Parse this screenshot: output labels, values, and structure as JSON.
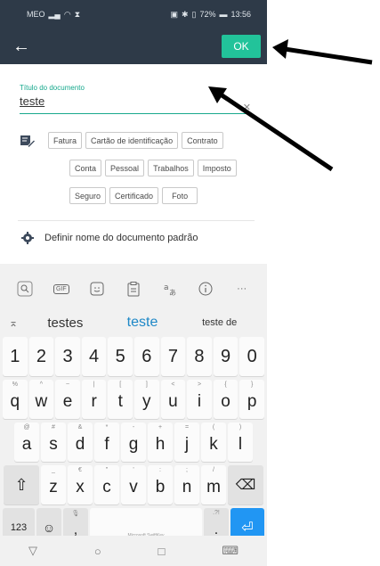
{
  "status_bar": {
    "carrier": "MEO",
    "right_text": "72%",
    "time": "13:56"
  },
  "app_bar": {
    "ok_label": "OK"
  },
  "title_field": {
    "label": "Título do documento",
    "value": "teste",
    "clear_glyph": "✕"
  },
  "tags": [
    "Fatura",
    "Cartão de identificação",
    "Contrato",
    "Conta",
    "Pessoal",
    "Trabalhos",
    "Imposto",
    "Seguro",
    "Certificado",
    "Foto"
  ],
  "default_name": {
    "label": "Definir nome do documento padrão"
  },
  "keyboard": {
    "toolbar": {
      "gif_label": "GIF",
      "more_label": "···"
    },
    "suggestions": [
      "testes",
      "teste",
      "teste de"
    ],
    "number_row": [
      "1",
      "2",
      "3",
      "4",
      "5",
      "6",
      "7",
      "8",
      "9",
      "0"
    ],
    "row1": [
      {
        "key": "q",
        "hint": "%"
      },
      {
        "key": "w",
        "hint": "^"
      },
      {
        "key": "e",
        "hint": "~"
      },
      {
        "key": "r",
        "hint": "|"
      },
      {
        "key": "t",
        "hint": "["
      },
      {
        "key": "y",
        "hint": "]"
      },
      {
        "key": "u",
        "hint": "<"
      },
      {
        "key": "i",
        "hint": ">"
      },
      {
        "key": "o",
        "hint": "{"
      },
      {
        "key": "p",
        "hint": "}"
      }
    ],
    "row2": [
      {
        "key": "a",
        "hint": "@"
      },
      {
        "key": "s",
        "hint": "#"
      },
      {
        "key": "d",
        "hint": "&"
      },
      {
        "key": "f",
        "hint": "*"
      },
      {
        "key": "g",
        "hint": "-"
      },
      {
        "key": "h",
        "hint": "+"
      },
      {
        "key": "j",
        "hint": "="
      },
      {
        "key": "k",
        "hint": "("
      },
      {
        "key": "l",
        "hint": ")"
      }
    ],
    "row3": [
      {
        "key": "z",
        "hint": "_"
      },
      {
        "key": "x",
        "hint": "€"
      },
      {
        "key": "c",
        "hint": "\""
      },
      {
        "key": "v",
        "hint": "'"
      },
      {
        "key": "b",
        "hint": ":"
      },
      {
        "key": "n",
        "hint": ";"
      },
      {
        "key": "m",
        "hint": "/"
      }
    ],
    "row4": {
      "numbers_label": "123",
      "comma_label": ",",
      "space_label": "Microsoft SwiftKey",
      "period_label": "."
    }
  },
  "annotation_color": "#000000",
  "accent_color": "#22c39a",
  "appbar_color": "#2e3a48"
}
